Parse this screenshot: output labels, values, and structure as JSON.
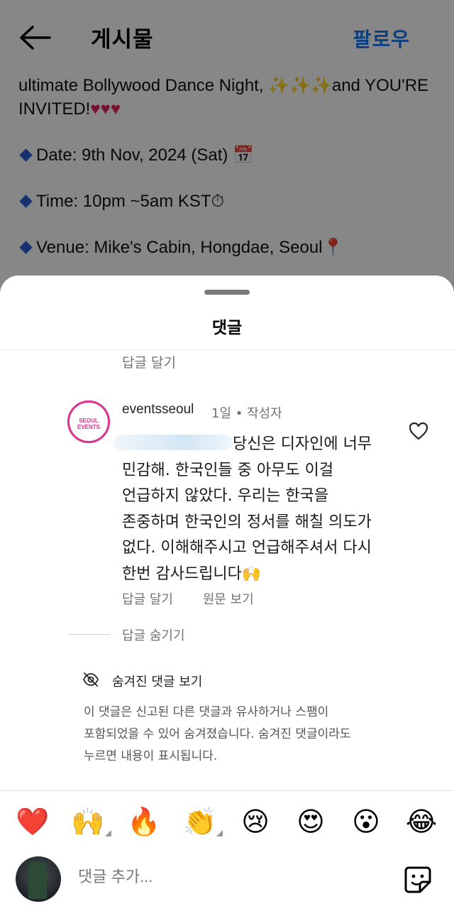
{
  "header": {
    "title": "게시물",
    "follow_label": "팔로우"
  },
  "caption": {
    "line1": "ultimate Bollywood Dance Night,",
    "line1_end": "and YOU'RE",
    "line2": "INVITED!",
    "date": "Date: 9th Nov, 2024 (Sat)",
    "time": "Time: 10pm ~5am KST",
    "venue": "Venue: Mike's Cabin, Hongdae, Seoul"
  },
  "sheet": {
    "title": "댓글",
    "reply_top": "답글 달기"
  },
  "comment": {
    "avatar_text_1": "SEOUL",
    "avatar_text_2": "EVENTS",
    "username": "eventsseoul",
    "time": "1일",
    "author_badge": "작성자",
    "line1": "당신은 디자인에 너무",
    "line2": "민감해. 한국인들 중 아무도 이걸",
    "line3": "언급하지 않았다. 우리는 한국을",
    "line4": "존중하며 한국인의 정서를 해칠 의도가",
    "line5": "없다. 이해해주시고 언급해주셔서 다시",
    "line6": "한번 감사드립니다",
    "reply": "답글 달기",
    "see_original": "원문 보기",
    "hide_replies": "답글 숨기기"
  },
  "hidden": {
    "label": "숨겨진 댓글 보기",
    "desc_line1": "이 댓글은 신고된 다른 댓글과 유사하거나 스팸이",
    "desc_line2": "포함되었을 수 있어 숨겨졌습니다. 숨겨진 댓글이라도",
    "desc_line3": "누르면 내용이 표시됩니다."
  },
  "emojis": [
    "❤️",
    "🙌",
    "🔥",
    "👏",
    "😢",
    "😍",
    "😮",
    "😂"
  ],
  "input": {
    "placeholder": "댓글 추가..."
  }
}
